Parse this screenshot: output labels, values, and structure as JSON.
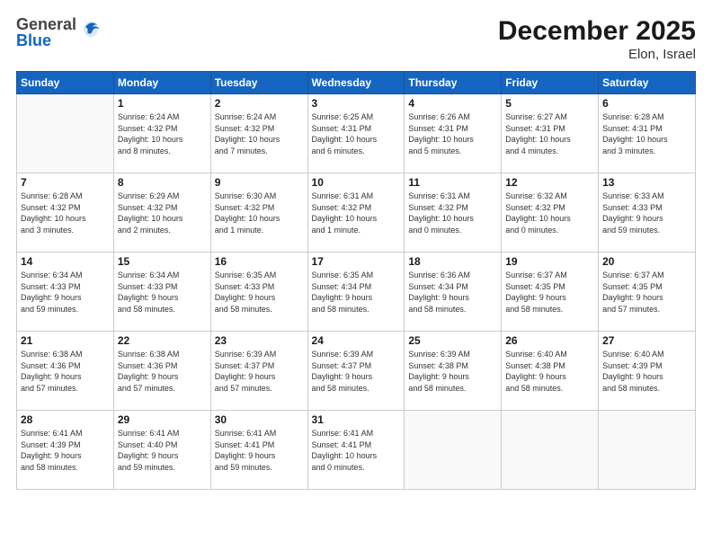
{
  "header": {
    "logo_general": "General",
    "logo_blue": "Blue",
    "month_title": "December 2025",
    "location": "Elon, Israel"
  },
  "days_of_week": [
    "Sunday",
    "Monday",
    "Tuesday",
    "Wednesday",
    "Thursday",
    "Friday",
    "Saturday"
  ],
  "weeks": [
    [
      {
        "day": "",
        "info": ""
      },
      {
        "day": "1",
        "info": "Sunrise: 6:24 AM\nSunset: 4:32 PM\nDaylight: 10 hours\nand 8 minutes."
      },
      {
        "day": "2",
        "info": "Sunrise: 6:24 AM\nSunset: 4:32 PM\nDaylight: 10 hours\nand 7 minutes."
      },
      {
        "day": "3",
        "info": "Sunrise: 6:25 AM\nSunset: 4:31 PM\nDaylight: 10 hours\nand 6 minutes."
      },
      {
        "day": "4",
        "info": "Sunrise: 6:26 AM\nSunset: 4:31 PM\nDaylight: 10 hours\nand 5 minutes."
      },
      {
        "day": "5",
        "info": "Sunrise: 6:27 AM\nSunset: 4:31 PM\nDaylight: 10 hours\nand 4 minutes."
      },
      {
        "day": "6",
        "info": "Sunrise: 6:28 AM\nSunset: 4:31 PM\nDaylight: 10 hours\nand 3 minutes."
      }
    ],
    [
      {
        "day": "7",
        "info": "Sunrise: 6:28 AM\nSunset: 4:32 PM\nDaylight: 10 hours\nand 3 minutes."
      },
      {
        "day": "8",
        "info": "Sunrise: 6:29 AM\nSunset: 4:32 PM\nDaylight: 10 hours\nand 2 minutes."
      },
      {
        "day": "9",
        "info": "Sunrise: 6:30 AM\nSunset: 4:32 PM\nDaylight: 10 hours\nand 1 minute."
      },
      {
        "day": "10",
        "info": "Sunrise: 6:31 AM\nSunset: 4:32 PM\nDaylight: 10 hours\nand 1 minute."
      },
      {
        "day": "11",
        "info": "Sunrise: 6:31 AM\nSunset: 4:32 PM\nDaylight: 10 hours\nand 0 minutes."
      },
      {
        "day": "12",
        "info": "Sunrise: 6:32 AM\nSunset: 4:32 PM\nDaylight: 10 hours\nand 0 minutes."
      },
      {
        "day": "13",
        "info": "Sunrise: 6:33 AM\nSunset: 4:33 PM\nDaylight: 9 hours\nand 59 minutes."
      }
    ],
    [
      {
        "day": "14",
        "info": "Sunrise: 6:34 AM\nSunset: 4:33 PM\nDaylight: 9 hours\nand 59 minutes."
      },
      {
        "day": "15",
        "info": "Sunrise: 6:34 AM\nSunset: 4:33 PM\nDaylight: 9 hours\nand 58 minutes."
      },
      {
        "day": "16",
        "info": "Sunrise: 6:35 AM\nSunset: 4:33 PM\nDaylight: 9 hours\nand 58 minutes."
      },
      {
        "day": "17",
        "info": "Sunrise: 6:35 AM\nSunset: 4:34 PM\nDaylight: 9 hours\nand 58 minutes."
      },
      {
        "day": "18",
        "info": "Sunrise: 6:36 AM\nSunset: 4:34 PM\nDaylight: 9 hours\nand 58 minutes."
      },
      {
        "day": "19",
        "info": "Sunrise: 6:37 AM\nSunset: 4:35 PM\nDaylight: 9 hours\nand 58 minutes."
      },
      {
        "day": "20",
        "info": "Sunrise: 6:37 AM\nSunset: 4:35 PM\nDaylight: 9 hours\nand 57 minutes."
      }
    ],
    [
      {
        "day": "21",
        "info": "Sunrise: 6:38 AM\nSunset: 4:36 PM\nDaylight: 9 hours\nand 57 minutes."
      },
      {
        "day": "22",
        "info": "Sunrise: 6:38 AM\nSunset: 4:36 PM\nDaylight: 9 hours\nand 57 minutes."
      },
      {
        "day": "23",
        "info": "Sunrise: 6:39 AM\nSunset: 4:37 PM\nDaylight: 9 hours\nand 57 minutes."
      },
      {
        "day": "24",
        "info": "Sunrise: 6:39 AM\nSunset: 4:37 PM\nDaylight: 9 hours\nand 58 minutes."
      },
      {
        "day": "25",
        "info": "Sunrise: 6:39 AM\nSunset: 4:38 PM\nDaylight: 9 hours\nand 58 minutes."
      },
      {
        "day": "26",
        "info": "Sunrise: 6:40 AM\nSunset: 4:38 PM\nDaylight: 9 hours\nand 58 minutes."
      },
      {
        "day": "27",
        "info": "Sunrise: 6:40 AM\nSunset: 4:39 PM\nDaylight: 9 hours\nand 58 minutes."
      }
    ],
    [
      {
        "day": "28",
        "info": "Sunrise: 6:41 AM\nSunset: 4:39 PM\nDaylight: 9 hours\nand 58 minutes."
      },
      {
        "day": "29",
        "info": "Sunrise: 6:41 AM\nSunset: 4:40 PM\nDaylight: 9 hours\nand 59 minutes."
      },
      {
        "day": "30",
        "info": "Sunrise: 6:41 AM\nSunset: 4:41 PM\nDaylight: 9 hours\nand 59 minutes."
      },
      {
        "day": "31",
        "info": "Sunrise: 6:41 AM\nSunset: 4:41 PM\nDaylight: 10 hours\nand 0 minutes."
      },
      {
        "day": "",
        "info": ""
      },
      {
        "day": "",
        "info": ""
      },
      {
        "day": "",
        "info": ""
      }
    ]
  ]
}
